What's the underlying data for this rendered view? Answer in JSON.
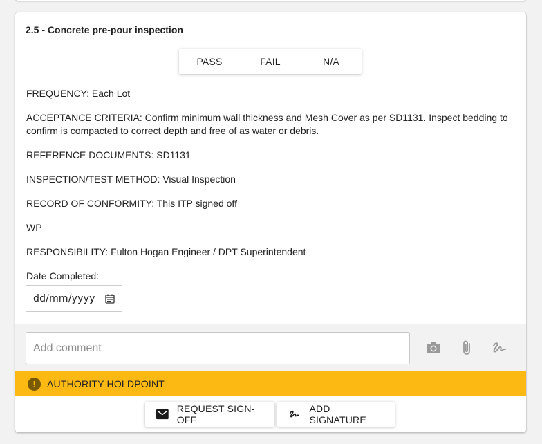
{
  "item": {
    "title": "2.5 - Concrete pre-pour inspection",
    "result_options": [
      "PASS",
      "FAIL",
      "N/A"
    ],
    "fields": [
      "FREQUENCY: Each Lot",
      "ACCEPTANCE CRITERIA: Confirm minimum wall thickness and Mesh Cover as per SD1131. Inspect bedding to confirm is compacted to correct depth and free of as water or debris.",
      "REFERENCE DOCUMENTS: SD1131",
      "INSPECTION/TEST METHOD: Visual Inspection",
      "RECORD OF CONFORMITY: This ITP signed off",
      "WP",
      "RESPONSIBILITY: Fulton Hogan Engineer / DPT Superintendent"
    ],
    "date_label": "Date Completed:",
    "date_placeholder": "dd/mm/yyyy",
    "date_icon": "calendar-icon"
  },
  "comment": {
    "placeholder": "Add comment",
    "icons": [
      "camera-icon",
      "paperclip-icon",
      "signature-icon"
    ]
  },
  "holdpoint": {
    "label": "AUTHORITY HOLDPOINT",
    "icon": "warning-icon",
    "color": "#fdb913"
  },
  "actions": {
    "request_signoff": "REQUEST SIGN-OFF",
    "request_signoff_icon": "envelope-icon",
    "add_signature": "ADD SIGNATURE",
    "add_signature_icon": "signature-icon"
  }
}
